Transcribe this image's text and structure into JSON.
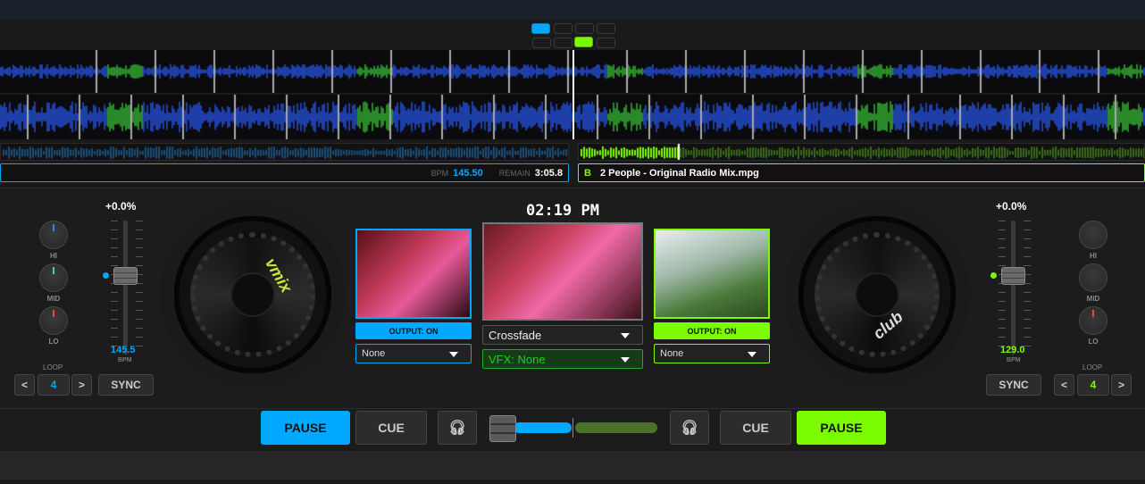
{
  "colors": {
    "deck_a": "#00a8ff",
    "deck_b": "#7cfc00",
    "vfx": "#22cc22"
  },
  "pads": {
    "row1_active": 0,
    "row2_active": 2
  },
  "deck_a": {
    "bpm_label": "BPM",
    "bpm": "145.50",
    "remain_label": "REMAIN",
    "remain": "3:05.8",
    "pitch": "+0.0%",
    "pitch_bpm": "145.5",
    "bpm_unit": "BPM",
    "eq": [
      "HI",
      "MID",
      "LO"
    ],
    "loop_label": "LOOP",
    "loop_value": "4",
    "loop_prev": "<",
    "loop_next": ">",
    "sync": "SYNC",
    "output": "OUTPUT: ON",
    "effect": "None",
    "pause": "PAUSE",
    "cue": "CUE",
    "jog_logo": "vmix"
  },
  "deck_b": {
    "letter": "B",
    "title": "2 People - Original Radio Mix.mpg",
    "pitch": "+0.0%",
    "pitch_bpm": "129.0",
    "bpm_unit": "BPM",
    "eq": [
      "HI",
      "MID",
      "LO"
    ],
    "loop_label": "LOOP",
    "loop_value": "4",
    "loop_prev": "<",
    "loop_next": ">",
    "sync": "SYNC",
    "output": "OUTPUT: ON",
    "effect": "None",
    "pause": "PAUSE",
    "cue": "CUE",
    "jog_logo": "club"
  },
  "center": {
    "clock": "02:19 PM",
    "transition": "Crossfade",
    "vfx": "VFX: None"
  },
  "crossfader": {
    "position": 0.0
  }
}
